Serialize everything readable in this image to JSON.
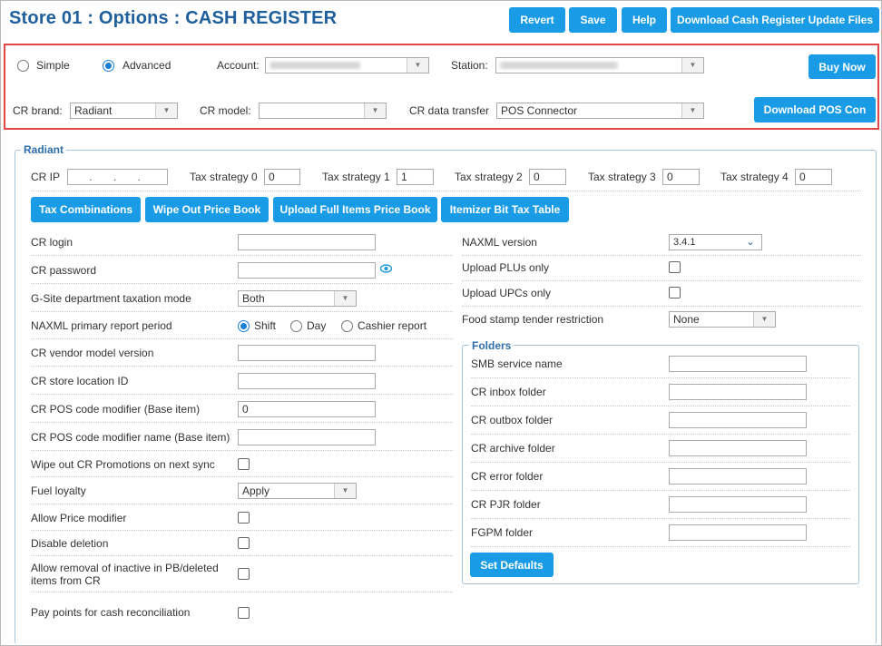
{
  "header": {
    "title": "Store 01 : Options : CASH REGISTER",
    "buttons": {
      "revert": "Revert",
      "save": "Save",
      "help": "Help",
      "download_updates": "Download Cash Register Update Files"
    }
  },
  "top_panel": {
    "mode_simple": "Simple",
    "mode_advanced": "Advanced",
    "mode_selected": "Advanced",
    "account_label": "Account:",
    "station_label": "Station:",
    "buy_now": "Buy Now",
    "cr_brand_label": "CR brand:",
    "cr_brand_value": "Radiant",
    "cr_model_label": "CR model:",
    "cr_model_value": "",
    "cr_data_transfer_label": "CR data transfer",
    "cr_data_transfer_value": "POS Connector",
    "download_pos": "Download POS Con"
  },
  "radiant": {
    "legend": "Radiant",
    "cr_ip_label": "CR IP",
    "cr_ip_value": ". . .",
    "tax_strategies": [
      {
        "label": "Tax strategy 0",
        "value": "0"
      },
      {
        "label": "Tax strategy 1",
        "value": "1"
      },
      {
        "label": "Tax strategy 2",
        "value": "0"
      },
      {
        "label": "Tax strategy 3",
        "value": "0"
      },
      {
        "label": "Tax strategy 4",
        "value": "0"
      }
    ],
    "actions": {
      "tax_combinations": "Tax Combinations",
      "wipe_price_book": "Wipe Out Price Book",
      "upload_full": "Upload Full Items Price Book",
      "itemizer": "Itemizer Bit Tax Table"
    },
    "left": {
      "cr_login": "CR login",
      "cr_password": "CR password",
      "gsite_mode": "G-Site department taxation mode",
      "gsite_mode_value": "Both",
      "naxml_period": "NAXML primary report period",
      "period_shift": "Shift",
      "period_day": "Day",
      "period_cashier": "Cashier report",
      "period_selected": "Shift",
      "vendor_model": "CR vendor model version",
      "store_location": "CR store location ID",
      "pos_modifier": "CR POS code modifier (Base item)",
      "pos_modifier_value": "0",
      "pos_modifier_name": "CR POS code modifier name (Base item)",
      "wipe_promotions": "Wipe out CR Promotions on next sync",
      "fuel_loyalty": "Fuel loyalty",
      "fuel_loyalty_value": "Apply",
      "allow_price_modifier": "Allow Price modifier",
      "disable_deletion": "Disable deletion",
      "allow_removal_1": "Allow removal of inactive in PB/deleted",
      "allow_removal_2": "items from CR",
      "pay_points": "Pay points for cash reconciliation"
    },
    "right": {
      "naxml_version": "NAXML version",
      "naxml_version_value": "3.4.1",
      "upload_plus": "Upload PLUs only",
      "upload_upcs": "Upload UPCs only",
      "food_stamp": "Food stamp tender restriction",
      "food_stamp_value": "None"
    },
    "folders": {
      "legend": "Folders",
      "smb": "SMB service name",
      "inbox": "CR inbox folder",
      "outbox": "CR outbox folder",
      "archive": "CR archive folder",
      "error": "CR error folder",
      "pjr": "CR PJR folder",
      "fgpm": "FGPM folder",
      "set_defaults": "Set Defaults"
    }
  }
}
